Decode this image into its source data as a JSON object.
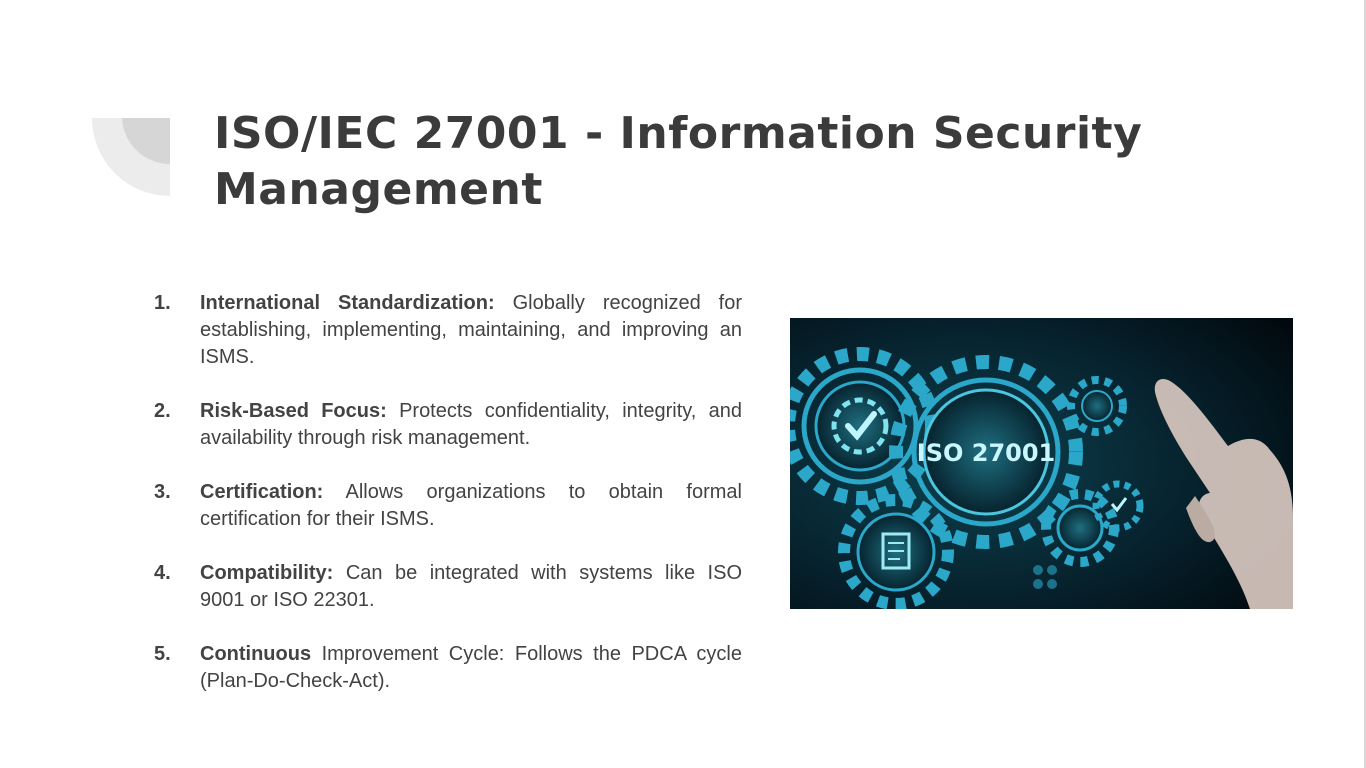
{
  "slide": {
    "title": "ISO/IEC 27001 - Information Security Management",
    "items": [
      {
        "number": "1.",
        "term": "International Standardization:",
        "text": " Globally recognized for establishing, implementing, maintaining, and improving an ISMS."
      },
      {
        "number": "2.",
        "term": "Risk-Based Focus:",
        "text": " Protects confidentiality, integrity, and availability through risk management."
      },
      {
        "number": "3.",
        "term": "Certification:",
        "text": " Allows organizations to obtain formal certification for their ISMS."
      },
      {
        "number": "4.",
        "term": "Compatibility:",
        "text": " Can be integrated with systems like ISO 9001 or ISO 22301."
      },
      {
        "number": "5.",
        "term": "Continuous",
        "text": " Improvement Cycle: Follows the PDCA cycle (Plan-Do-Check-Act)."
      }
    ],
    "image": {
      "label": "ISO 27001",
      "colors": {
        "background": "#03141c",
        "gear": "#2aa7c9",
        "glow": "#7fe3f0"
      }
    },
    "colors": {
      "title": "#3b3b3b",
      "text": "#434343",
      "decoration": "#d9d9d9"
    }
  }
}
